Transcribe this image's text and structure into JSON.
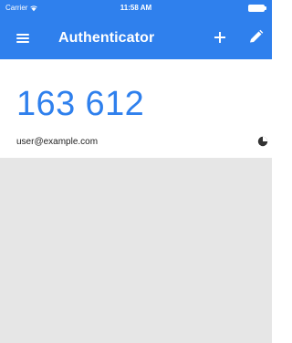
{
  "status_bar": {
    "carrier": "Carrier",
    "time": "11:58 AM",
    "icons": [
      "wifi-icon",
      "battery-icon"
    ]
  },
  "app_bar": {
    "title": "Authenticator",
    "left_icon": "menu-icon",
    "right_icons": [
      "plus-icon",
      "pencil-icon"
    ]
  },
  "accounts": [
    {
      "code": "163 612",
      "account": "user@example.com",
      "timer_icon": "timer-icon"
    }
  ],
  "colors": {
    "accent": "#2f80ed",
    "background": "#e6e6e6",
    "card": "#ffffff",
    "text": "#222222"
  }
}
